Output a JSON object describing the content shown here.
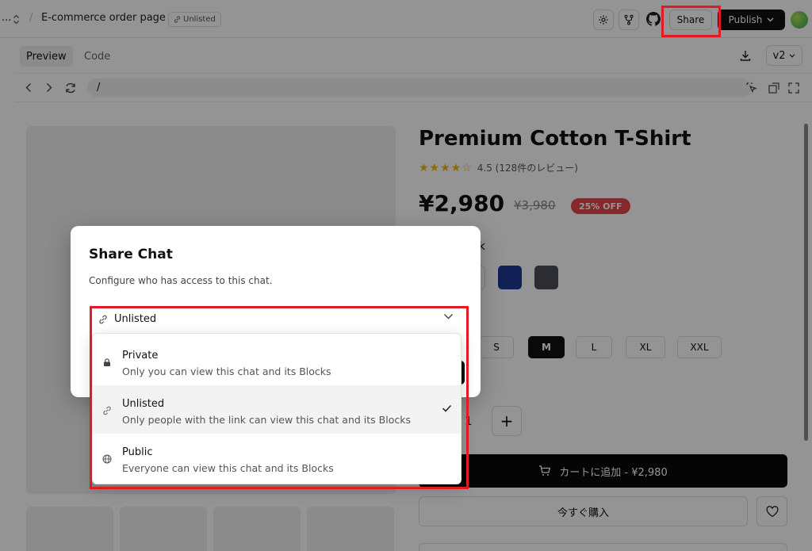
{
  "topbar": {
    "ellipsis": "...",
    "separator": "/",
    "project_name": "E-commerce order page",
    "visibility_badge": "Unlisted",
    "share_label": "Share",
    "publish_label": "Publish",
    "settings_icon": "gear-icon",
    "fork_icon": "git-branch-icon",
    "github_icon": "github-icon"
  },
  "tabs": {
    "preview": "Preview",
    "code": "Code",
    "version": "v2"
  },
  "urlbar": {
    "path": "/"
  },
  "product": {
    "title": "Premium Cotton T-Shirt",
    "stars": "★★★★☆",
    "rating_text": "4.5 (128件のレビュー)",
    "price": "¥2,980",
    "old_price": "¥3,980",
    "discount": "25% OFF",
    "color_label_partial": "ck",
    "swatch_colors": [
      "#1f3a93",
      "#4a4f57"
    ],
    "sizes": [
      "S",
      "M",
      "L",
      "XL",
      "XXL"
    ],
    "selected_size": "M",
    "quantity_partial": "1",
    "plus": "+",
    "cart_button": "カートに追加 - ¥2,980",
    "buy_button": "今すぐ購入"
  },
  "dialog": {
    "title": "Share Chat",
    "description": "Configure who has access to this chat.",
    "selected": "Unlisted",
    "options": [
      {
        "title": "Private",
        "description": "Only you can view this chat and its Blocks",
        "icon": "lock-icon"
      },
      {
        "title": "Unlisted",
        "description": "Only people with the link can view this chat and its Blocks",
        "icon": "link-icon",
        "selected": true
      },
      {
        "title": "Public",
        "description": "Everyone can view this chat and its Blocks",
        "icon": "globe-icon"
      }
    ]
  },
  "colors": {
    "accent_dark": "#111111",
    "discount_red": "#e5484d",
    "highlight_red": "#e01b24",
    "star_yellow": "#f5b301"
  }
}
